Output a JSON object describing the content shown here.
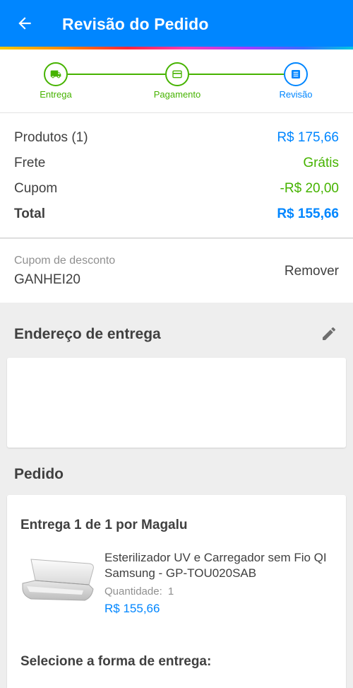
{
  "header": {
    "title": "Revisão do Pedido"
  },
  "steps": [
    {
      "label": "Entrega",
      "icon": "truck-icon",
      "state": "done"
    },
    {
      "label": "Pagamento",
      "icon": "card-icon",
      "state": "done"
    },
    {
      "label": "Revisão",
      "icon": "list-icon",
      "state": "active"
    }
  ],
  "summary": {
    "products_label": "Produtos (1)",
    "products_value": "R$ 175,66",
    "shipping_label": "Frete",
    "shipping_value": "Grátis",
    "coupon_label": "Cupom",
    "coupon_value": "-R$ 20,00",
    "total_label": "Total",
    "total_value": "R$ 155,66"
  },
  "coupon": {
    "label": "Cupom de desconto",
    "code": "GANHEI20",
    "remove_label": "Remover"
  },
  "address": {
    "title": "Endereço de entrega"
  },
  "order": {
    "title": "Pedido",
    "delivery_title": "Entrega 1 de 1 por Magalu",
    "product_name": "Esterilizador UV e Carregador sem Fio QI Samsung - GP-TOU020SAB",
    "quantity_label": "Quantidade:",
    "quantity_value": "1",
    "product_price": "R$ 155,66",
    "shipping_method_title": "Selecione a forma de entrega:"
  },
  "colors": {
    "primary": "#0086ff",
    "success": "#46b300",
    "text": "#404040",
    "muted": "#909090"
  }
}
